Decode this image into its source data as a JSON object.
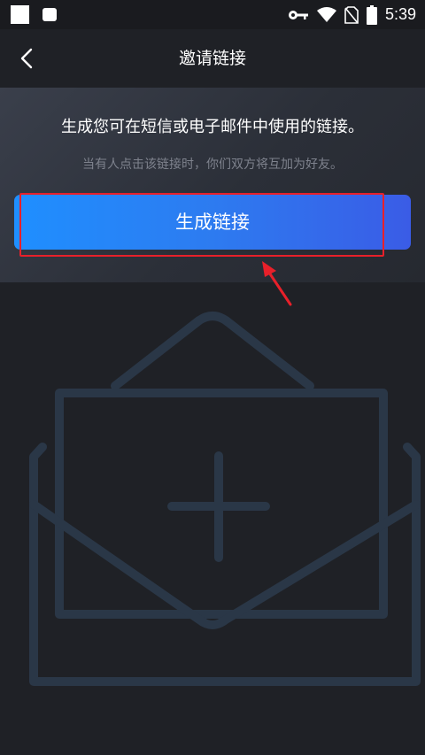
{
  "status_bar": {
    "time": "5:39",
    "icons": [
      "square-icon",
      "notification-icon",
      "key-icon",
      "wifi-icon",
      "no-sim-icon",
      "battery-icon"
    ]
  },
  "header": {
    "back_icon": "chevron-left-icon",
    "title": "邀请链接"
  },
  "invite": {
    "description": "生成您可在短信或电子邮件中使用的链接。",
    "subtext": "当有人点击该链接时，你们双方将互加为好友。",
    "generate_button_label": "生成链接"
  },
  "annotation": {
    "highlight_color": "#e8202a"
  },
  "colors": {
    "background": "#1f2126",
    "panel": "#2e323b",
    "button_gradient_start": "#1f8fff",
    "button_gradient_end": "#3a5ce6",
    "illustration": "#2a3747"
  },
  "illustration": {
    "icon": "envelope-plus-icon"
  }
}
